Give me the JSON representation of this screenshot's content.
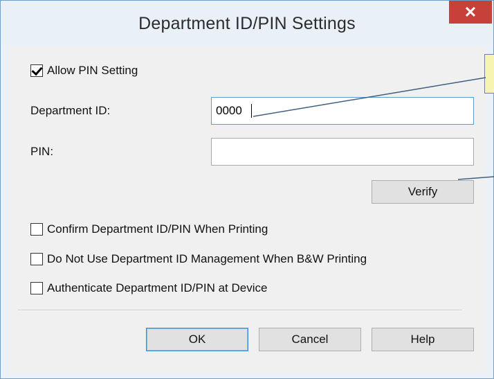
{
  "window": {
    "title": "Department ID/PIN Settings",
    "close_glyph": "✕"
  },
  "allow_pin": {
    "label": "Allow PIN Setting",
    "checked": true
  },
  "department_id": {
    "label": "Department ID:",
    "value": "0000"
  },
  "pin": {
    "label": "PIN:",
    "value": ""
  },
  "verify_button": {
    "label": "Verify"
  },
  "options": [
    {
      "label": "Confirm Department ID/PIN When Printing",
      "checked": false
    },
    {
      "label": "Do Not Use Department ID Management When B&W Printing",
      "checked": false
    },
    {
      "label": "Authenticate Department ID/PIN at Device",
      "checked": false
    }
  ],
  "buttons": {
    "ok": "OK",
    "cancel": "Cancel",
    "help": "Help"
  },
  "colors": {
    "accent": "#3c8fd8",
    "close": "#c7413a",
    "callout": "#f7f3b0"
  }
}
